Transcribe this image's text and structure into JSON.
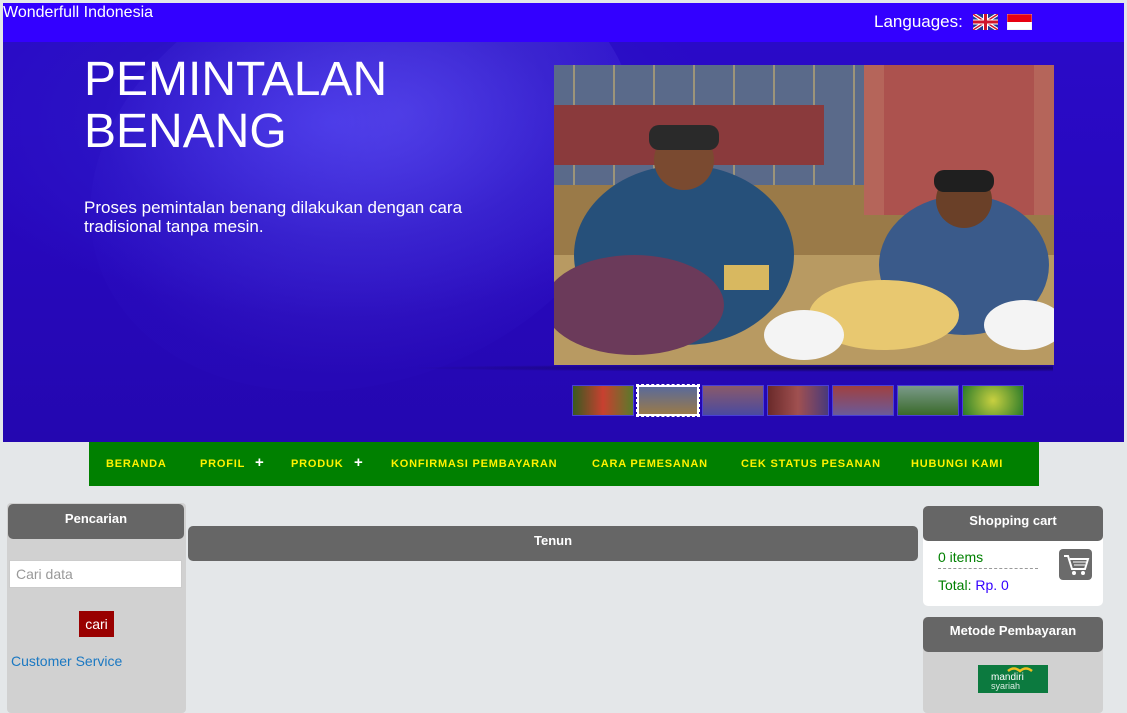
{
  "header": {
    "site_name": "Wonderfull Indonesia",
    "languages_label": "Languages:",
    "flags": [
      "uk-flag-icon",
      "indonesia-flag-icon"
    ]
  },
  "hero": {
    "title": "PEMINTALAN BENANG",
    "description": "Proses pemintalan benang dilakukan dengan cara tradisional tanpa mesin.",
    "thumbnail_count": 7,
    "active_thumbnail": 2
  },
  "nav": {
    "items": [
      "BERANDA",
      "PROFIL",
      "PRODUK",
      "KONFIRMASI PEMBAYARAN",
      "CARA PEMESANAN",
      "CEK STATUS PESANAN",
      "HUBUNGI KAMI"
    ],
    "plus_symbol": "+"
  },
  "sidebar_left": {
    "title": "Pencarian",
    "search_placeholder": "Cari data",
    "search_button": "cari",
    "link": "Customer Service"
  },
  "main": {
    "section_title": "Tenun"
  },
  "cart": {
    "title": "Shopping cart",
    "items": "0 items",
    "total_label": "Total:",
    "total_value": "Rp. 0"
  },
  "payment": {
    "title": "Metode Pembayaran",
    "bank_name": "mandiri",
    "bank_sub": "syariah"
  },
  "colors": {
    "topbar": "#3300ff",
    "nav_bg": "#008000",
    "nav_text": "#fff200",
    "search_button": "#990000"
  }
}
